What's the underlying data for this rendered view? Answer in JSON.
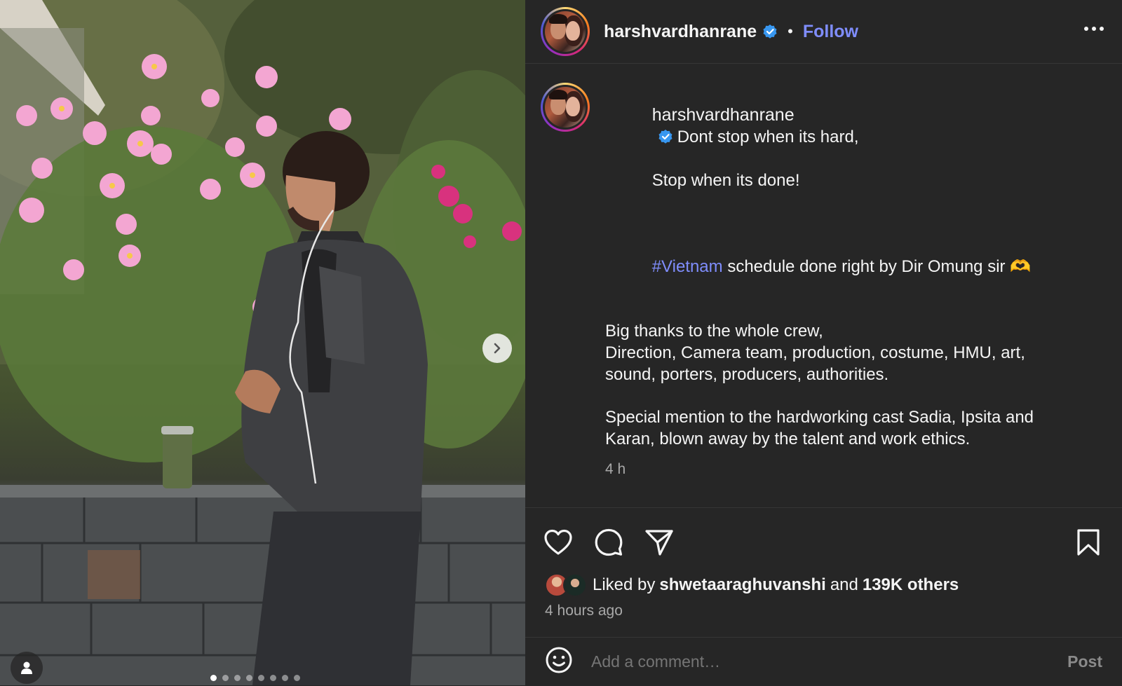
{
  "header": {
    "username": "harshvardhanrane",
    "separator": "•",
    "follow_label": "Follow"
  },
  "caption": {
    "username": "harshvardhanrane",
    "line1": "Dont stop when its hard,",
    "line2": "Stop when its done!",
    "hashtag": "#Vietnam",
    "line3_rest": " schedule done right by Dir Omung sir 🫶",
    "paragraph2": "Big thanks to the whole crew,\nDirection, Camera team, production, costume, HMU, art, sound, porters, producers, authorities.",
    "paragraph3": "Special mention to the hardworking cast Sadia, Ipsita and Karan, blown away by the talent and work ethics.",
    "time": "4 h"
  },
  "likes": {
    "prefix": "Liked by",
    "user": "shwetaaraghuvanshi",
    "connector": "and",
    "others": "139K others",
    "time_ago": "4 hours ago"
  },
  "comment": {
    "placeholder": "Add a comment…",
    "post_label": "Post"
  },
  "carousel": {
    "slide_count": 8,
    "active_index": 0
  },
  "colors": {
    "background": "#262626",
    "link_accent": "#7f8dfc",
    "verified_badge": "#3897f0",
    "secondary_text": "#a8a8a8"
  },
  "icons": {
    "like": "heart-icon",
    "comment": "comment-icon",
    "share": "share-icon",
    "save": "bookmark-icon",
    "emoji": "emoji-icon",
    "next": "chevron-right-icon",
    "tags": "user-tag-icon",
    "more": "more-options-icon",
    "verified": "verified-badge-icon"
  }
}
